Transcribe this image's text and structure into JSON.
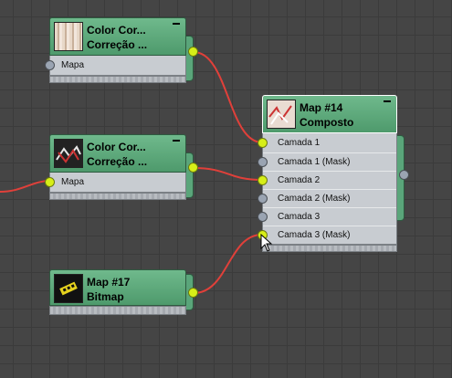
{
  "nodes": {
    "cc1": {
      "title": "Color Cor...",
      "subtitle": "Correção ...",
      "slots": [
        "Mapa"
      ]
    },
    "cc2": {
      "title": "Color Cor...",
      "subtitle": "Correção ...",
      "slots": [
        "Mapa"
      ]
    },
    "bitmap": {
      "title": "Map #17",
      "subtitle": "Bitmap"
    },
    "composite": {
      "title": "Map #14",
      "subtitle": "Composto",
      "slots": [
        "Camada 1",
        "Camada 1 (Mask)",
        "Camada 2",
        "Camada 2 (Mask)",
        "Camada 3",
        "Camada 3 (Mask)"
      ]
    }
  },
  "colors": {
    "wire": "#e0403a",
    "port_connected": "#d7ee18",
    "port_empty": "#9aa4b2",
    "header": "#5aa57a",
    "body": "#c8ccd1"
  },
  "icons": [
    "minimize-icon",
    "wood-texture-thumbnail",
    "ribbon-texture-thumbnail",
    "composite-texture-thumbnail",
    "bitmap-thumbnail"
  ]
}
